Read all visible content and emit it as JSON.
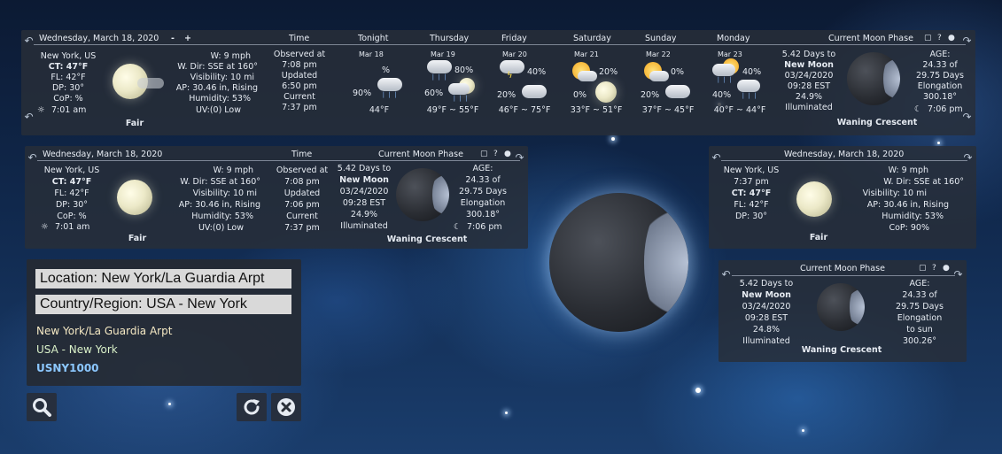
{
  "date": "Wednesday, March 18, 2020",
  "zoom_minus": "-",
  "zoom_plus": "+",
  "col_time": "Time",
  "moon_header": "Current Moon Phase",
  "icons": {
    "toggle": "▢",
    "help": "?",
    "drop": "●",
    "arrow_left": "↶",
    "arrow_right": "↷"
  },
  "current": {
    "city": "New York, US",
    "ct": "CT: 47°F",
    "fl": "FL: 42°F",
    "dp": "DP: 30°",
    "cop": "CoP: %",
    "cop_small": "CoP: 90%",
    "sunrise": "7:01 am",
    "condition": "Fair",
    "wind": "W: 9 mph",
    "wdir": "W. Dir: SSE at 160°",
    "vis": "Visibility: 10 mi",
    "ap": "AP: 30.46 in, Rising",
    "humidity": "Humidity: 53%",
    "uv": "UV:(0) Low",
    "observed_label": "Observed at",
    "observed": "7:08 pm",
    "updated_label": "Updated",
    "updated_top": "6:50 pm",
    "updated_mid": "7:06 pm",
    "current_label": "Current",
    "current_time": "7:37 pm",
    "small_time": "7:37 pm"
  },
  "forecast": [
    {
      "day": "Tonight",
      "date": "Mar 18",
      "pct": "%",
      "pct2": "90%",
      "temp": "44°F"
    },
    {
      "day": "Thursday",
      "date": "Mar 19",
      "pct": "80%",
      "pct2": "60%",
      "temp": "49°F ~ 55°F"
    },
    {
      "day": "Friday",
      "date": "Mar 20",
      "pct": "40%",
      "pct2": "20%",
      "temp": "46°F ~ 75°F"
    },
    {
      "day": "Saturday",
      "date": "Mar 21",
      "pct": "20%",
      "pct2": "0%",
      "temp": "33°F ~ 51°F"
    },
    {
      "day": "Sunday",
      "date": "Mar 22",
      "pct": "0%",
      "pct2": "20%",
      "temp": "37°F ~ 45°F"
    },
    {
      "day": "Monday",
      "date": "Mar 23",
      "pct": "40%",
      "pct2": "40%",
      "temp": "40°F ~ 44°F"
    }
  ],
  "moon": {
    "days_to": "5.42 Days to",
    "new_moon": "New Moon",
    "date": "03/24/2020",
    "time": "09:28 EST",
    "illum_top": "24.9%",
    "illum_small": "24.8%",
    "illum_label": "Illuminated",
    "age_label": "AGE:",
    "age": "24.33 of",
    "age2": "29.75 Days",
    "elong": "Elongation",
    "elong_deg": "300.18°",
    "to_sun": "to sun",
    "elong_small": "300.26°",
    "moonset": "7:06 pm",
    "phase": "Waning Crescent"
  },
  "location": {
    "location_field": "Location: New York/La Guardia Arpt",
    "country_field": "Country/Region: USA - New York",
    "name": "New York/La Guardia Arpt",
    "region": "USA - New York",
    "code": "USNY1000"
  },
  "colors": {
    "name": "#f5e9c4",
    "region": "#d9f0c8",
    "code": "#8cc8ff"
  },
  "buttons": {
    "search": "search-icon",
    "refresh": "refresh-icon",
    "close": "close-icon"
  }
}
